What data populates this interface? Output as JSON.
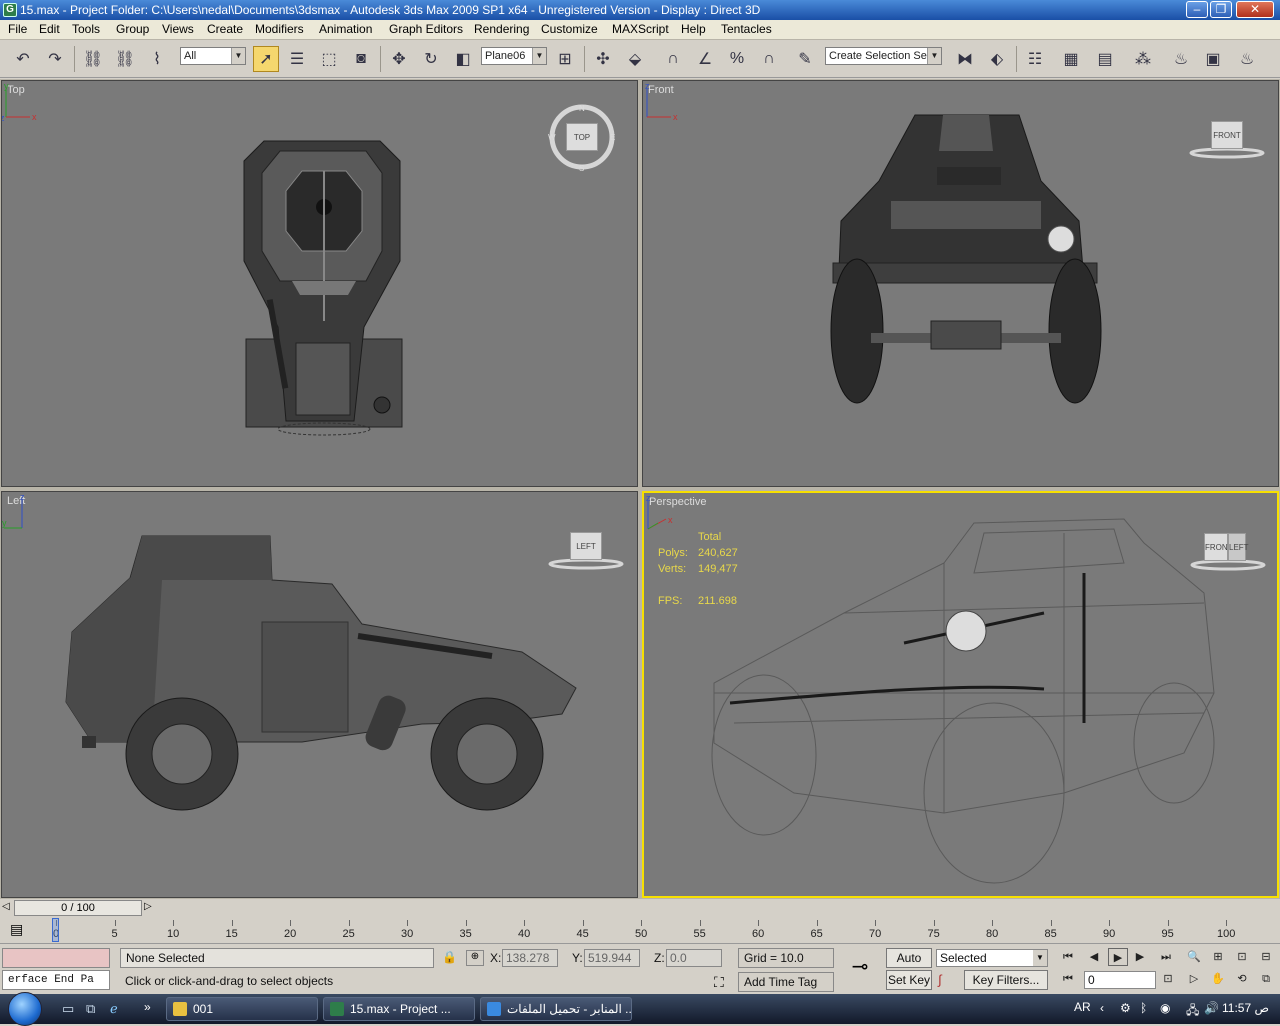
{
  "window": {
    "title": "15.max     - Project Folder: C:\\Users\\nedal\\Documents\\3dsmax      - Autodesk 3ds Max  2009 SP1  x64   - Unregistered Version     - Display : Direct 3D",
    "icon": "3dsmax-app-icon"
  },
  "menu": [
    "File",
    "Edit",
    "Tools",
    "Group",
    "Views",
    "Create",
    "Modifiers",
    "Animation",
    "Graph Editors",
    "Rendering",
    "Customize",
    "MAXScript",
    "Help",
    "Tentacles"
  ],
  "toolbar": {
    "filter_value": "All",
    "reference_coord_value": "Plane06",
    "named_selection_value": "Create Selection Set"
  },
  "viewports": {
    "top": {
      "label": "Top",
      "cube": "TOP"
    },
    "front": {
      "label": "Front",
      "cube": "FRONT"
    },
    "left": {
      "label": "Left",
      "cube": "LEFT"
    },
    "perspective": {
      "label": "Perspective",
      "cube_front": "FRONT",
      "cube_side": "LEFT"
    }
  },
  "stats": {
    "header": "Total",
    "polys_label": "Polys:",
    "polys_value": "240,627",
    "verts_label": "Verts:",
    "verts_value": "149,477",
    "fps_label": "FPS:",
    "fps_value": "211.698"
  },
  "timeline": {
    "slider_text": "0 / 100",
    "ticks": [
      "0",
      "5",
      "10",
      "15",
      "20",
      "25",
      "30",
      "35",
      "40",
      "45",
      "50",
      "55",
      "60",
      "65",
      "70",
      "75",
      "80",
      "85",
      "90",
      "95",
      "100"
    ]
  },
  "status": {
    "listener_text": "erface End Pa",
    "selection": "None Selected",
    "prompt": "Click or click-and-drag to select objects",
    "x_label": "X:",
    "x_value": "138.278",
    "y_label": "Y:",
    "y_value": "519.944",
    "z_label": "Z:",
    "z_value": "0.0",
    "grid": "Grid = 10.0",
    "add_time_tag": "Add Time Tag",
    "auto_key": "Auto Key",
    "set_key": "Set Key",
    "key_mode_value": "Selected",
    "key_filters": "Key Filters...",
    "frame_value": "0"
  },
  "taskbar": {
    "tasks": [
      "001",
      "15.max     - Project ...",
      "المنابر - تحميل الملفات ..."
    ],
    "lang": "AR",
    "clock": "11:57 ص"
  }
}
